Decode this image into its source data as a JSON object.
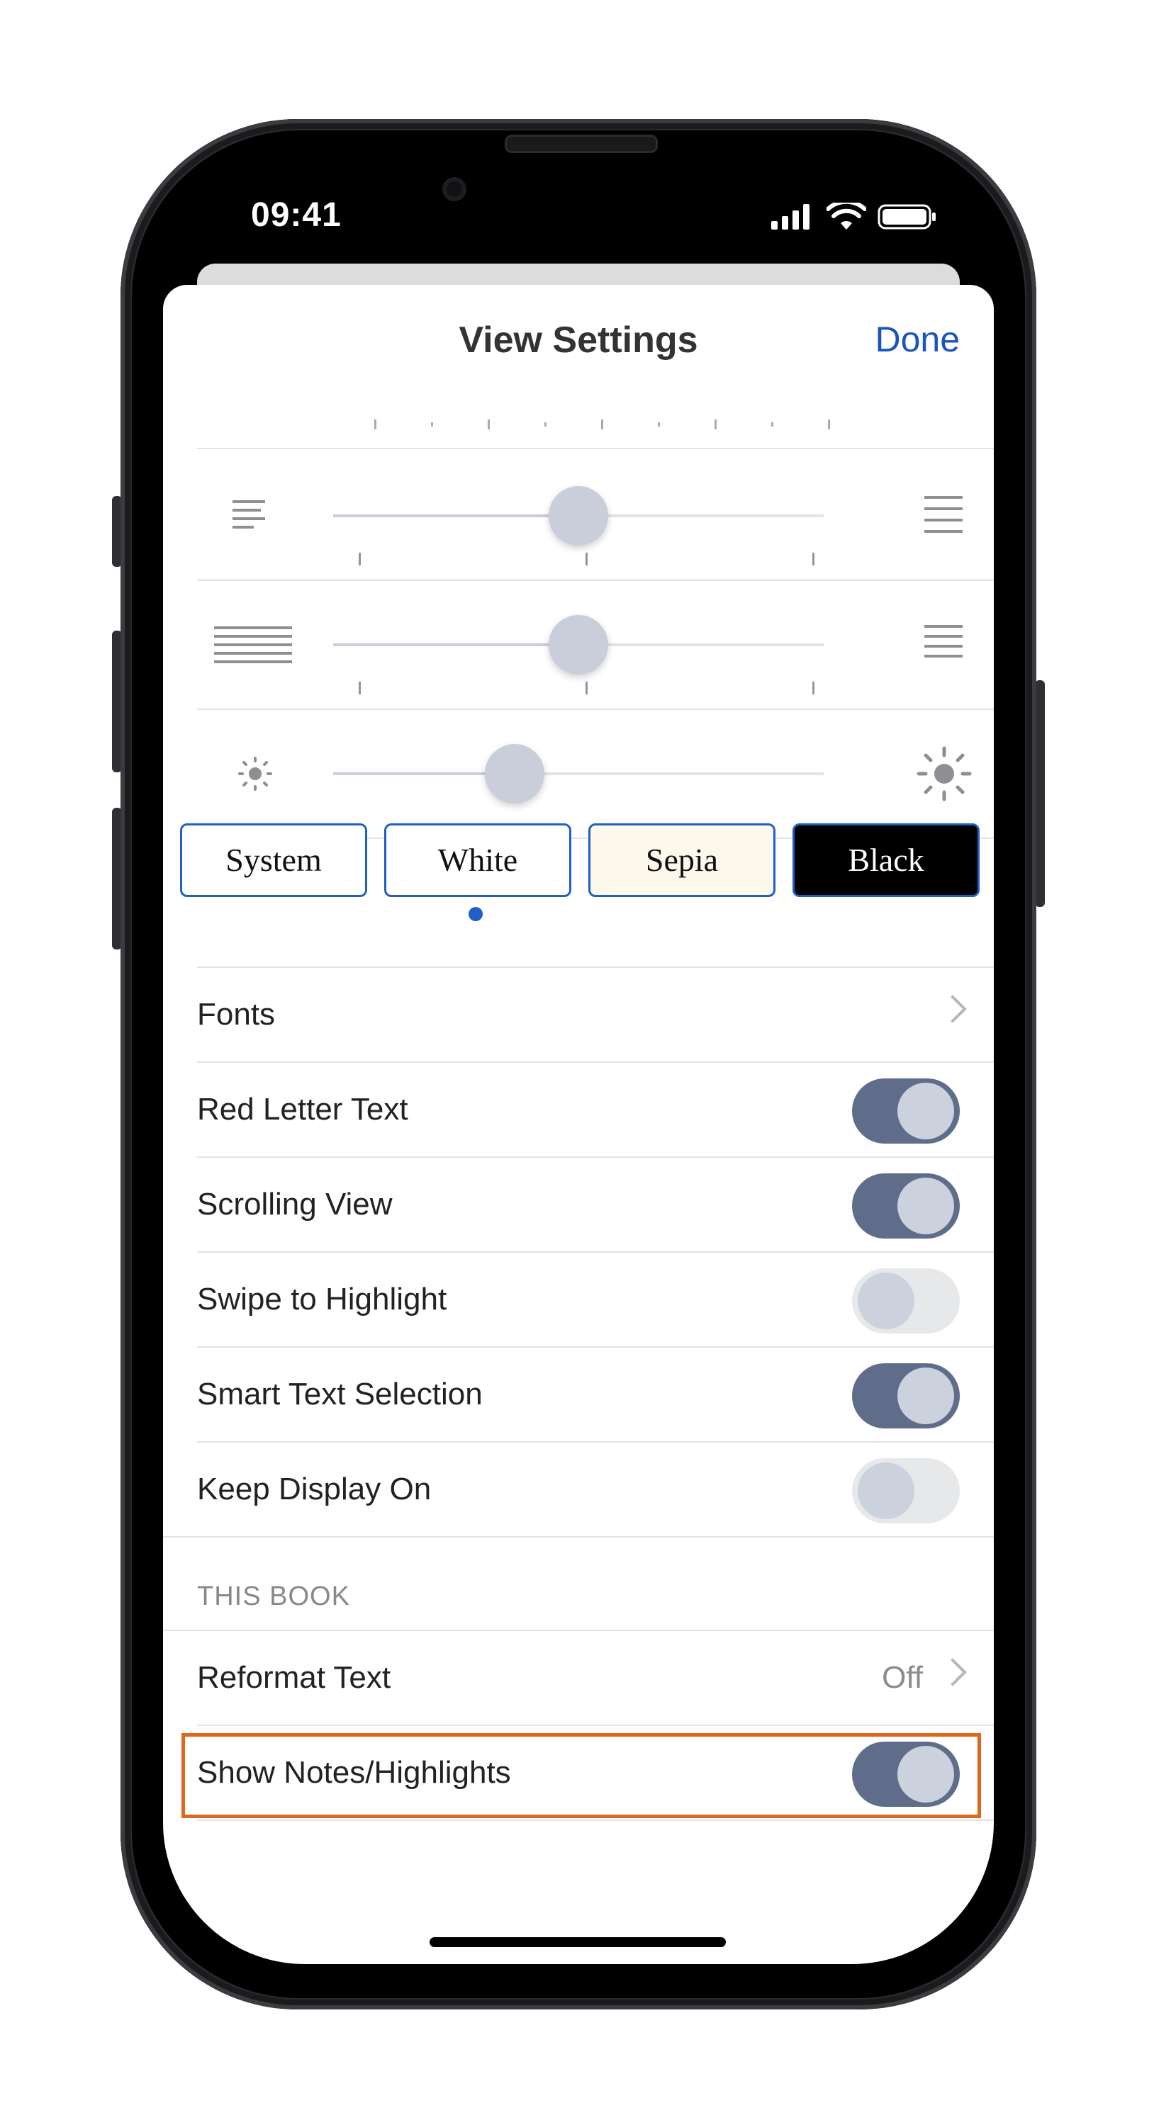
{
  "status_bar": {
    "time": "09:41"
  },
  "header": {
    "title": "View Settings",
    "done_label": "Done"
  },
  "sliders": [
    {
      "name": "margins",
      "value": 0.5
    },
    {
      "name": "line-spacing",
      "value": 0.5
    },
    {
      "name": "brightness",
      "value": 0.37
    }
  ],
  "themes": {
    "items": [
      {
        "label": "System",
        "bg": "#ffffff",
        "fg": "#111111"
      },
      {
        "label": "White",
        "bg": "#ffffff",
        "fg": "#111111"
      },
      {
        "label": "Sepia",
        "bg": "#fdf8ec",
        "fg": "#111111"
      },
      {
        "label": "Black",
        "bg": "#000000",
        "fg": "#ffffff"
      }
    ],
    "selected": "White"
  },
  "settings": [
    {
      "label": "Fonts",
      "type": "link"
    },
    {
      "label": "Red Letter Text",
      "type": "toggle",
      "on": true
    },
    {
      "label": "Scrolling View",
      "type": "toggle",
      "on": true
    },
    {
      "label": "Swipe to Highlight",
      "type": "toggle",
      "on": false
    },
    {
      "label": "Smart Text Selection",
      "type": "toggle",
      "on": true
    },
    {
      "label": "Keep Display On",
      "type": "toggle",
      "on": false
    }
  ],
  "this_book": {
    "section_title": "THIS BOOK",
    "reformat": {
      "label": "Reformat Text",
      "value": "Off"
    },
    "notes": {
      "label": "Show Notes/Highlights",
      "on": true
    }
  },
  "colors": {
    "accent": "#1a56b8",
    "toggle_on": "#5f6d8a",
    "toggle_off": "#e7e8ea",
    "highlight_box": "#e0661b"
  }
}
